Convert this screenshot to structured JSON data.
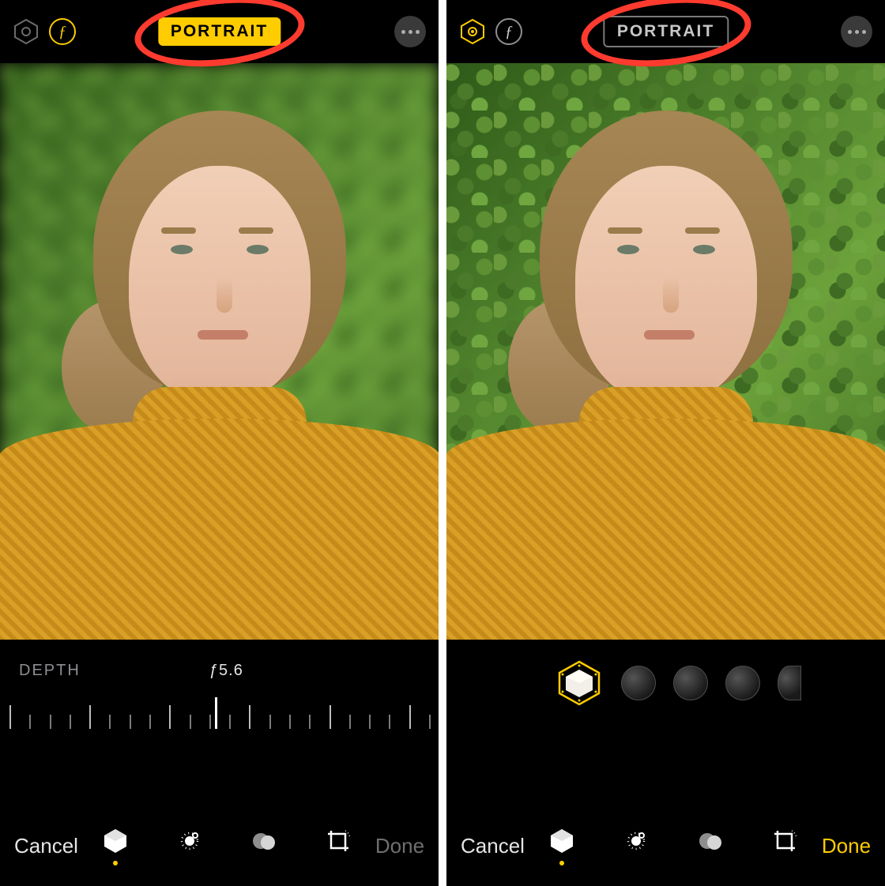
{
  "left": {
    "portrait_active": true,
    "mode_label": "PORTRAIT",
    "f_icon_color": "yellow",
    "hex_icon_color": "gray",
    "depth_label": "DEPTH",
    "depth_value": "ƒ5.6",
    "cancel": "Cancel",
    "done": "Done",
    "done_enabled": false,
    "active_tool": "portrait"
  },
  "right": {
    "portrait_active": false,
    "mode_label": "PORTRAIT",
    "f_icon_color": "gray",
    "hex_icon_color": "yellow",
    "cancel": "Cancel",
    "done": "Done",
    "done_enabled": true,
    "active_tool": "portrait"
  },
  "colors": {
    "accent": "#ffcc00",
    "annotation": "#ff3b2f"
  },
  "tools": [
    "portrait-cube",
    "adjust",
    "filters",
    "crop"
  ]
}
